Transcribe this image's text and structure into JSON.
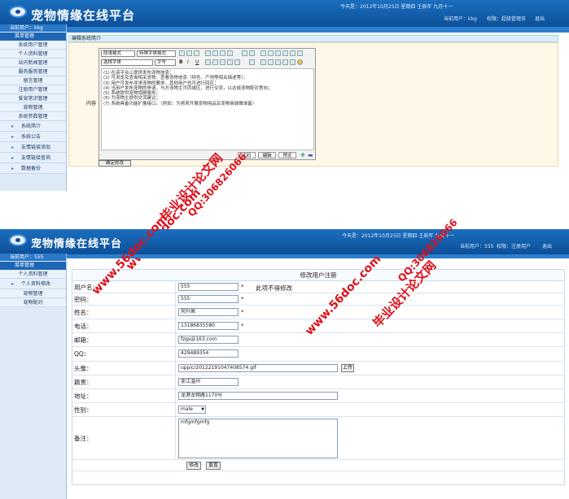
{
  "top": {
    "header": {
      "title": "宠物情缘在线平台",
      "date_info": "今天是：2012年10月25日 星期四 壬辰年 九月十一",
      "user_info": "当前用户：kkg",
      "role_info": "权限：超级管理员",
      "logout": "退出"
    },
    "sidebar": {
      "user": "当前用户：kkg",
      "section": "菜单管理",
      "items": [
        "系统用户管理",
        "个人资料管理",
        "站内新闻管理",
        "服务服务管理",
        "留言管理",
        "注册用户管理",
        "爱宠常识管理",
        "宠物管理",
        "系统参数管理"
      ],
      "sub_items": [
        "系统简介",
        "系统公告",
        "友情链接添加",
        "友情链接查询",
        "数据备份"
      ]
    },
    "editor": {
      "header": "编辑系统简介",
      "field_label": "内容",
      "selects": [
        "段落格式",
        "特殊字体格式",
        "选择字体",
        "字号"
      ],
      "content_lines": [
        "(1) 在该平台上提供发布宠物信息；",
        "(2) 可浏览及查询相关宠物，查看宠物信息（特色、产地等相关描述等）；",
        "(3) 用户可发布寻求宠物的要求，其他用户也可进行回应；",
        "(4) 当用户发布宠物的申请，与方宠物主可同城区，进行交流，以达成宠物配对意向；",
        "(5) 系统提供宠物增删服务；",
        "(6) 为宠物主提供交流建议；",
        "(7) 系统具备功能扩展接口。（例如：为将来开展宠物用品及宠物商城做准备）"
      ],
      "tabs": [
        "代码",
        "编辑",
        "预览"
      ],
      "submit": "确定修改"
    }
  },
  "bottom": {
    "header": {
      "title": "宠物情缘在线平台",
      "date_info": "今天是：2012年10月25日 星期四 壬辰年 九月十一",
      "user_info": "当前用户：555",
      "role_info": "权限：注册用户",
      "logout": "退出"
    },
    "sidebar": {
      "user": "当前用户：555",
      "section": "菜单管理",
      "items": [
        "个人资料管理",
        "个人资料修改",
        "宠物管理",
        "宠物配对"
      ]
    },
    "form": {
      "title": "修改用户注册",
      "fields": {
        "username": {
          "label": "用户名：",
          "value": "555",
          "note": "此项不得修改"
        },
        "password": {
          "label": "密码：",
          "value": "555"
        },
        "name": {
          "label": "姓名：",
          "value": "何升高"
        },
        "phone": {
          "label": "电话：",
          "value": "13186835580"
        },
        "email": {
          "label": "邮箱：",
          "value": "fzgs@163.com"
        },
        "qq": {
          "label": "QQ：",
          "value": "429489354"
        },
        "avatar": {
          "label": "头像：",
          "value": "uppic/20122191047408574.gif",
          "upload": "上传"
        },
        "origin": {
          "label": "籍贯：",
          "value": "浙江温州"
        },
        "address": {
          "label": "地址：",
          "value": "龙港龙翔路1170号"
        },
        "gender": {
          "label": "性别：",
          "value": "male"
        },
        "remark": {
          "label": "备注：",
          "value": "mfgmfgmfg"
        }
      },
      "star": "*",
      "buttons": {
        "submit": "修改",
        "reset": "重置"
      }
    }
  },
  "watermarks": {
    "site": "www.56doc.com",
    "qq": "QQ:306826066",
    "brand": "毕业设计论文网"
  },
  "colors": {
    "header_blue": "#0d4f98",
    "watermark_red": "#e0101a"
  }
}
